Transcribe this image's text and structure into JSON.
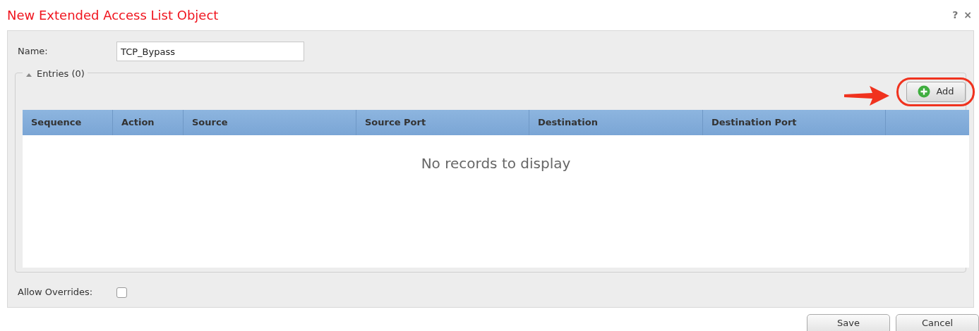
{
  "dialog": {
    "title": "New Extended Access List Object",
    "help": "?",
    "close": "×"
  },
  "name_field": {
    "label": "Name:",
    "value": "TCP_Bypass"
  },
  "entries": {
    "legend": "Entries (0)",
    "expanded": true,
    "add_button": "Add",
    "columns": [
      "Sequence",
      "Action",
      "Source",
      "Source Port",
      "Destination",
      "Destination Port"
    ],
    "empty_text": "No records to display"
  },
  "allow_overrides": {
    "label": "Allow Overrides:",
    "checked": false
  },
  "buttons": [
    "Save",
    "Cancel"
  ]
}
